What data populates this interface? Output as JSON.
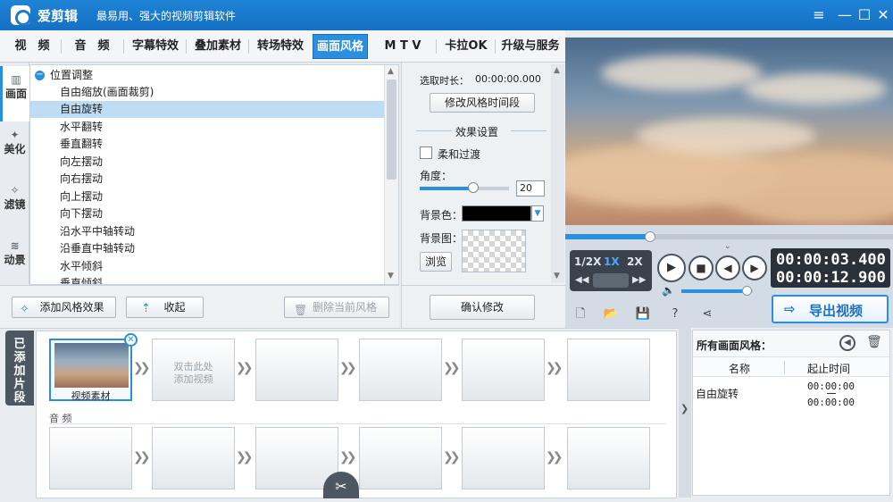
{
  "app": {
    "name": "爱剪辑",
    "slogan": "最易用、强大的视频剪辑软件"
  },
  "window_controls": {
    "menu": "≡",
    "minimize": "—",
    "maximize": "☐",
    "close": "✕"
  },
  "tabs": [
    "视　频",
    "音　频",
    "字幕特效",
    "叠加素材",
    "转场特效",
    "画面风格",
    "M T V",
    "卡拉OK",
    "升级与服务"
  ],
  "active_tab": "画面风格",
  "side_nav": [
    {
      "label": "画面",
      "active": true
    },
    {
      "label": "美化",
      "active": false
    },
    {
      "label": "滤镜",
      "active": false
    },
    {
      "label": "动景",
      "active": false
    }
  ],
  "style_list": {
    "group": "位置调整",
    "items": [
      "自由缩放(画面裁剪)",
      "自由旋转",
      "水平翻转",
      "垂直翻转",
      "向左摆动",
      "向右摆动",
      "向上摆动",
      "向下摆动",
      "沿水平中轴转动",
      "沿垂直中轴转动",
      "水平倾斜",
      "垂直倾斜"
    ],
    "selected": "自由旋转"
  },
  "settings": {
    "duration_label": "选取时长：",
    "duration_value": "00:00:00.000",
    "modify_time_button": "修改风格时间段",
    "effect_settings_title": "效果设置",
    "soft_transition_label": "柔和过渡",
    "angle_label": "角度：",
    "angle_value": "20",
    "angle_slider_fraction": 0.6,
    "bg_color_label": "背景色：",
    "bg_color": "#000000",
    "bg_image_label": "背景图：",
    "browse_button": "浏览"
  },
  "list_toolbar": {
    "add_effect": "添加风格效果",
    "collapse": "收起",
    "delete_current": "删除当前风格",
    "confirm": "确认修改"
  },
  "player": {
    "progress_fraction": 0.26,
    "speeds": [
      "1/2X",
      "1X",
      "2X"
    ],
    "active_speed": "1X",
    "current_time": "00:00:03.400",
    "total_time": "00:00:12.900",
    "volume_fraction": 0.92,
    "export_button": "导出视频"
  },
  "timeline": {
    "added_tab_label": "已添加片段",
    "video_clip_label": "视频素材",
    "add_video_hint_line1": "双击此处",
    "add_video_hint_line2": "添加视频",
    "audio_label": "音 频"
  },
  "styles_panel": {
    "title": "所有画面风格：",
    "col_name": "名称",
    "col_time": "起止时间",
    "rows": [
      {
        "name": "自由旋转",
        "start": "00:00:00",
        "end": "00:00:00"
      }
    ]
  },
  "colors": {
    "accent": "#2b8fe0",
    "titlebar": "#1b7ad0"
  }
}
